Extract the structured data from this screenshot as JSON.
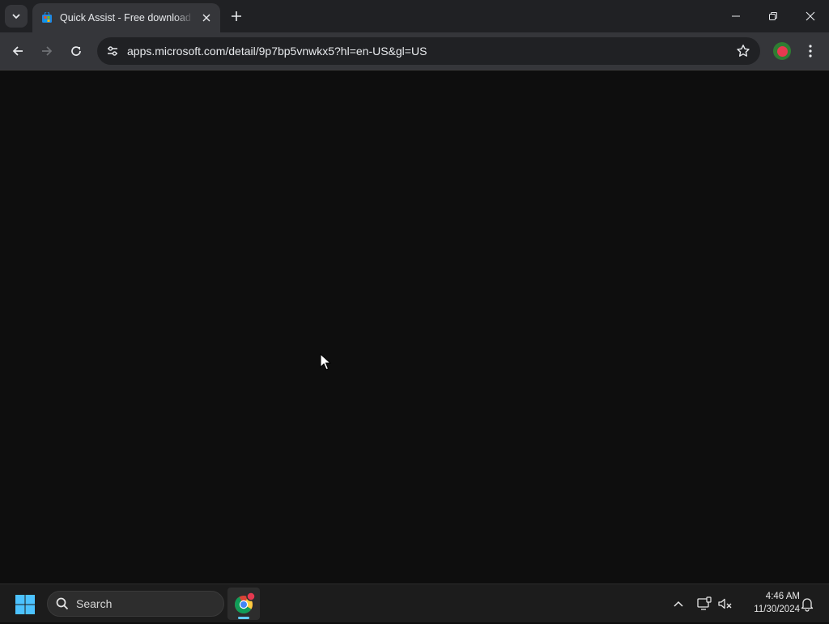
{
  "browser": {
    "tab": {
      "title": "Quick Assist - Free download and install on Windows | Microsoft Store"
    },
    "address_bar": {
      "url": "apps.microsoft.com/detail/9p7bp5vnwkx5?hl=en-US&gl=US"
    },
    "icons": {
      "tab_search": "chevron-down-icon",
      "favicon": "microsoft-store-icon",
      "tab_close": "close-icon",
      "new_tab": "plus-icon",
      "minimize": "minimize-icon",
      "restore": "restore-icon",
      "close": "close-icon",
      "back": "arrow-left-icon",
      "forward": "arrow-right-icon",
      "reload": "reload-icon",
      "site_info": "tune-icon",
      "bookmark": "star-icon",
      "profile": "profile-avatar",
      "menu": "kebab-menu-icon"
    }
  },
  "taskbar": {
    "search_label": "Search",
    "clock": {
      "time": "4:46 AM",
      "date": "11/30/2024"
    },
    "icons": {
      "start": "windows-logo-icon",
      "search": "search-icon",
      "pinned_app": "chrome-icon",
      "tray_overflow": "chevron-up-icon",
      "network": "network-icon",
      "volume": "volume-muted-icon",
      "notifications": "bell-icon"
    }
  },
  "colors": {
    "page_background": "#0e0e0e",
    "tabstrip": "#202124",
    "toolbar": "#35363a",
    "taskbar": "#1c1c1c",
    "accent": "#60cdff"
  }
}
